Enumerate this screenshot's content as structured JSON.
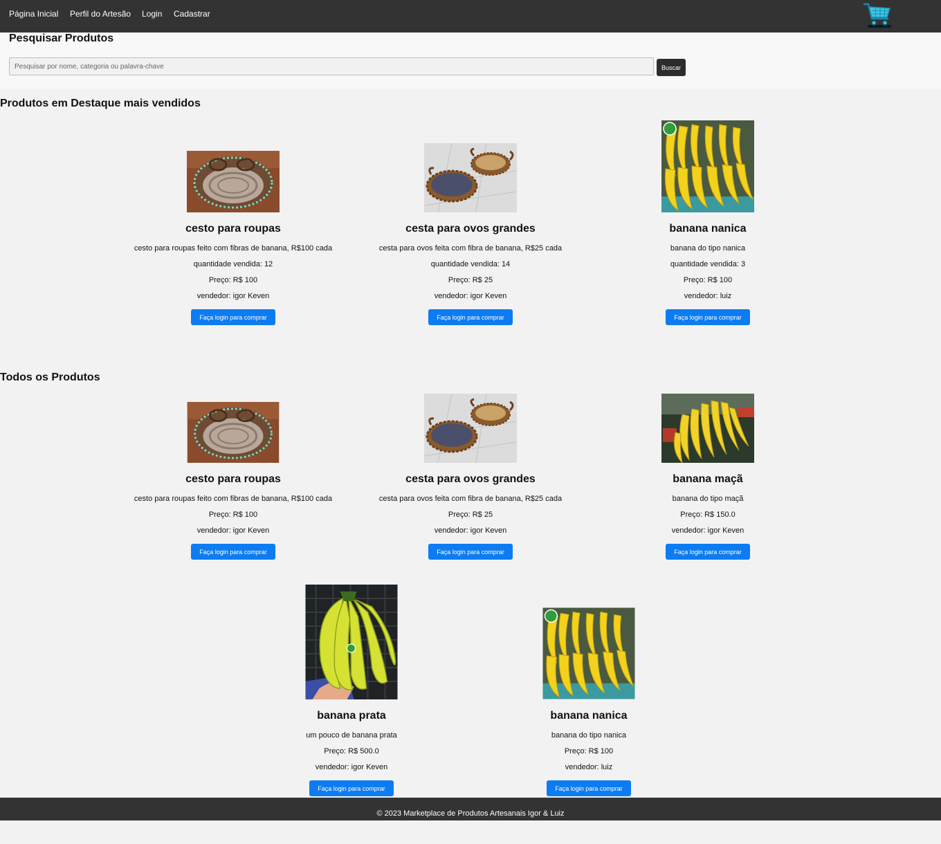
{
  "nav": {
    "home": "Página Inicial",
    "artisan_profile": "Perfil do Artesão",
    "login": "Login",
    "register": "Cadastrar"
  },
  "search": {
    "title": "Pesquisar Produtos",
    "placeholder": "Pesquisar por nome, categoria ou palavra-chave",
    "button": "Buscar"
  },
  "featured": {
    "title": "Produtos em Destaque mais vendidos",
    "products": [
      {
        "name": "cesto para roupas",
        "description": "cesto para roupas feito com fibras de banana, R$100 cada",
        "sold": "quantidade vendida: 12",
        "price": "Preço: R$ 100",
        "seller": "vendedor: igor Keven",
        "button": "Faça login para comprar"
      },
      {
        "name": "cesta para ovos grandes",
        "description": "cesta para ovos feita com fibra de banana, R$25 cada",
        "sold": "quantidade vendida: 14",
        "price": "Preço: R$ 25",
        "seller": "vendedor: igor Keven",
        "button": "Faça login para comprar"
      },
      {
        "name": "banana nanica",
        "description": "banana do tipo nanica",
        "sold": "quantidade vendida: 3",
        "price": "Preço: R$ 100",
        "seller": "vendedor: luiz",
        "button": "Faça login para comprar"
      }
    ]
  },
  "all": {
    "title": "Todos os Produtos",
    "products": [
      {
        "name": "cesto para roupas",
        "description": "cesto para roupas feito com fibras de banana, R$100 cada",
        "price": "Preço: R$ 100",
        "seller": "vendedor: igor Keven",
        "button": "Faça login para comprar"
      },
      {
        "name": "cesta para ovos grandes",
        "description": "cesta para ovos feita com fibra de banana, R$25 cada",
        "price": "Preço: R$ 25",
        "seller": "vendedor: igor Keven",
        "button": "Faça login para comprar"
      },
      {
        "name": "banana maçã",
        "description": "banana do tipo maçã",
        "price": "Preço: R$ 150.0",
        "seller": "vendedor: igor Keven",
        "button": "Faça login para comprar"
      },
      {
        "name": "banana prata",
        "description": "um pouco de banana prata",
        "price": "Preço: R$ 500.0",
        "seller": "vendedor: igor Keven",
        "button": "Faça login para comprar"
      },
      {
        "name": "banana nanica",
        "description": "banana do tipo nanica",
        "price": "Preço: R$ 100",
        "seller": "vendedor: luiz",
        "button": "Faça login para comprar"
      }
    ]
  },
  "footer": {
    "text": "© 2023 Marketplace de Produtos Artesanais Igor & Luiz"
  },
  "icons": {
    "cart": "shopping-cart-icon"
  },
  "colors": {
    "nav_bg": "#333333",
    "button_blue": "#0d7cf2",
    "search_button": "#2d2d2d"
  }
}
